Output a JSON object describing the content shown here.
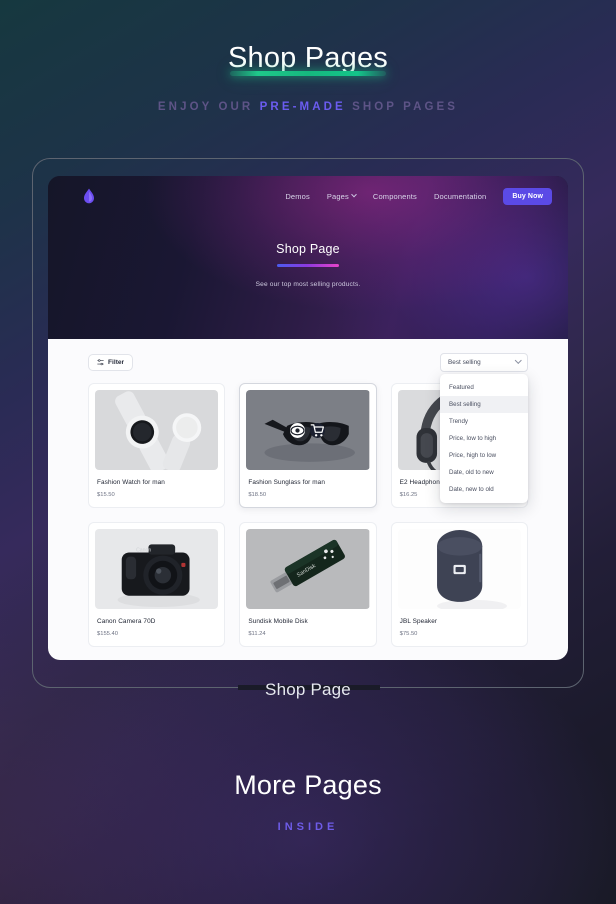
{
  "hero": {
    "title": "Shop Pages",
    "sub_pre": "ENJOY OUR",
    "sub_accent": "PRE-MADE",
    "sub_post": "SHOP PAGES"
  },
  "mockup": {
    "caption": "Shop Page",
    "nav": {
      "logo_icon": "droplet-icon",
      "links": [
        {
          "label": "Demos",
          "has_chevron": false
        },
        {
          "label": "Pages",
          "has_chevron": true
        },
        {
          "label": "Components",
          "has_chevron": false
        },
        {
          "label": "Documentation",
          "has_chevron": false
        }
      ],
      "buy_label": "Buy Now"
    },
    "screen_hero": {
      "title": "Shop Page",
      "subtitle": "See our top most selling products."
    },
    "toolbar": {
      "filter_label": "Filter",
      "filter_icon": "sliders-icon",
      "sort_value": "Best selling",
      "sort_chevron_icon": "chevron-down-icon",
      "sort_options": [
        "Featured",
        "Best selling",
        "Trendy",
        "Price, low to high",
        "Price, high to low",
        "Date, old to new",
        "Date, new to old"
      ],
      "sort_selected": "Best selling"
    },
    "products": [
      {
        "name": "Fashion Watch for man",
        "price": "$15.50",
        "image": "smartwatch",
        "hover": false
      },
      {
        "name": "Fashion Sunglass for man",
        "price": "$18.50",
        "image": "sunglasses",
        "hover": true
      },
      {
        "name": "E2 Headphone",
        "price": "$16.25",
        "image": "headphone",
        "hover": false
      },
      {
        "name": "Canon Camera 70D",
        "price": "$155.40",
        "image": "camera",
        "hover": false
      },
      {
        "name": "Sundisk Mobile Disk",
        "price": "$11.24",
        "image": "usb-drive",
        "hover": false
      },
      {
        "name": "JBL Speaker",
        "price": "$75.50",
        "image": "speaker",
        "hover": false
      }
    ],
    "hover_icons": {
      "eye": "eye-icon",
      "cart": "cart-icon"
    }
  },
  "more": {
    "title": "More Pages",
    "subtitle": "INSIDE"
  },
  "colors": {
    "accent_green": "#1fc98a",
    "accent_purple": "#6b5cf0",
    "buy_button": "#5b4ae6",
    "panel_bg": "#fbfbfd"
  }
}
